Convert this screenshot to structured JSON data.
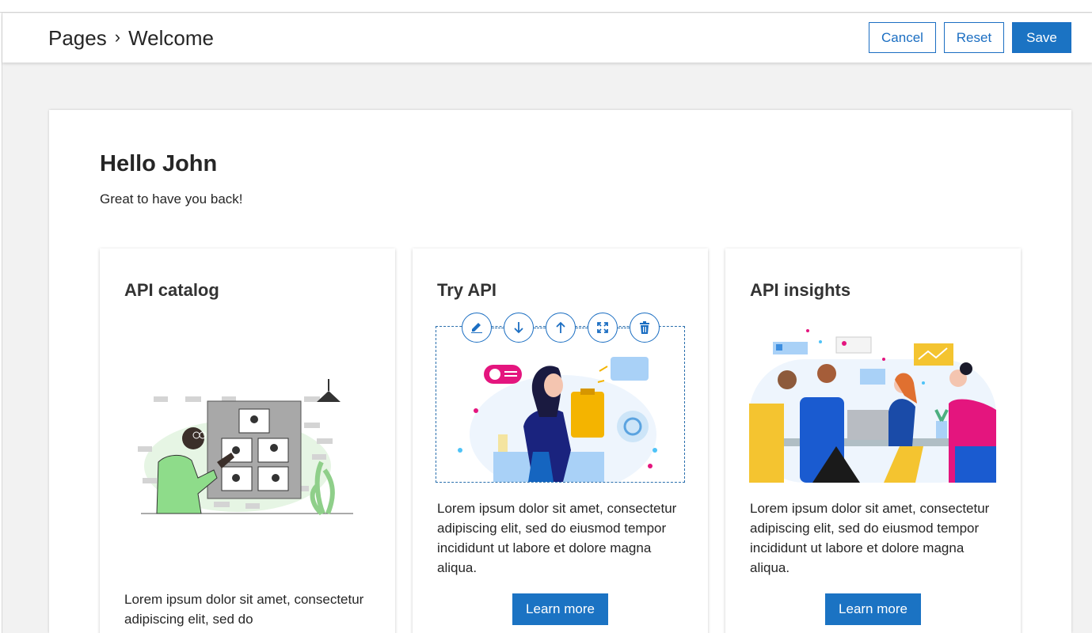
{
  "header": {
    "breadcrumb_root": "Pages",
    "breadcrumb_sep": "›",
    "breadcrumb_current": "Welcome",
    "cancel_label": "Cancel",
    "reset_label": "Reset",
    "save_label": "Save"
  },
  "welcome": {
    "title": "Hello John",
    "subtitle": "Great to have you back!"
  },
  "cards": [
    {
      "title": "API catalog",
      "text": "Lorem ipsum dolor sit amet, consectetur adipiscing elit, sed do",
      "illustration": "man-presenting-storyboard"
    },
    {
      "title": "Try API",
      "text": "Lorem ipsum dolor sit amet, consectetur adipiscing elit, sed do eiusmod tempor incididunt ut labore et dolore magna aliqua.",
      "button": "Learn more",
      "illustration": "woman-with-clipboard",
      "toolbar": [
        "pencil-icon",
        "arrow-down-icon",
        "arrow-up-icon",
        "expand-icon",
        "trash-icon"
      ]
    },
    {
      "title": "API insights",
      "text": "Lorem ipsum dolor sit amet, consectetur adipiscing elit, sed do eiusmod tempor incididunt ut labore et dolore magna aliqua.",
      "button": "Learn more",
      "illustration": "team-meeting"
    }
  ],
  "colors": {
    "accent": "#1b73c3",
    "page_bg": "#f2f2f2",
    "text": "#262626"
  }
}
